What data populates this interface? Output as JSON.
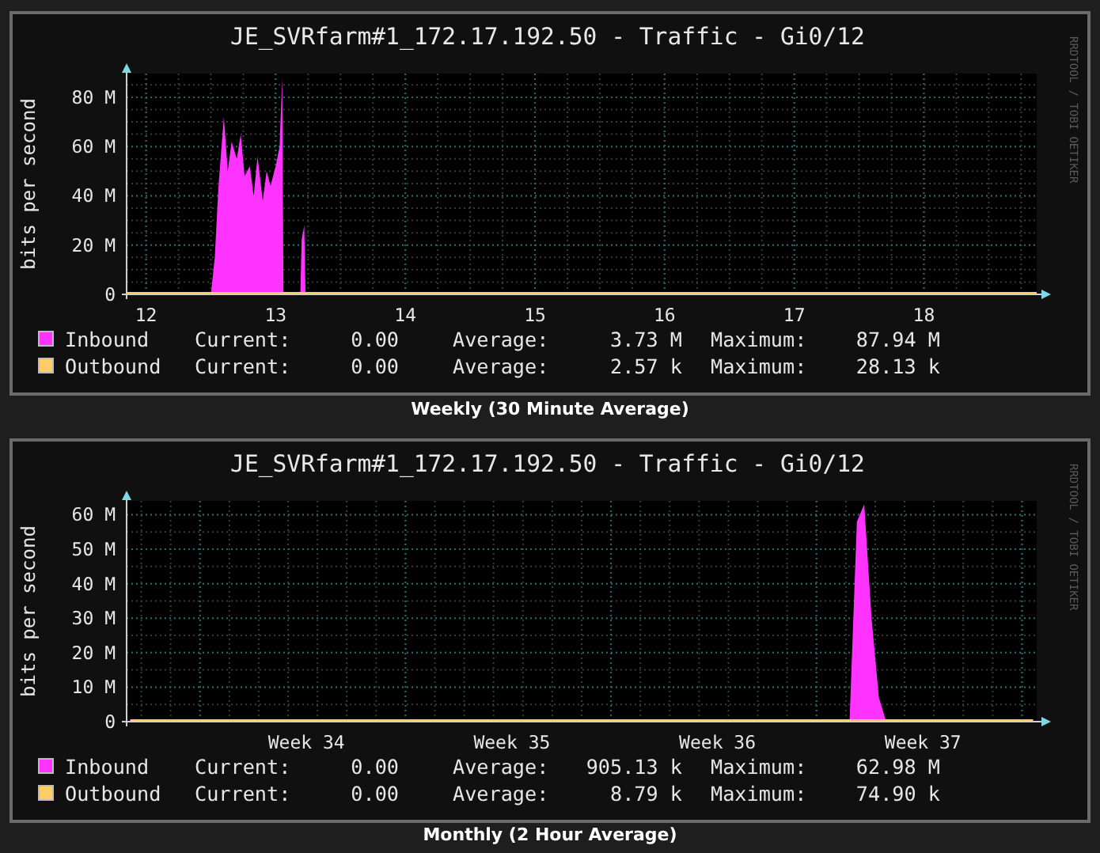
{
  "graphs": [
    {
      "title": "JE_SVRfarm#1_172.17.192.50 - Traffic - Gi0/12",
      "credit": "RRDTOOL / TOBI OETIKER",
      "caption": "Weekly (30 Minute Average)",
      "chart_data": {
        "type": "area",
        "ylabel": "bits per second",
        "grid": true,
        "legend": "bottom",
        "xlim": [
          11.85,
          18.87
        ],
        "ylim": [
          0,
          89.6
        ],
        "x": [
          11.85,
          12.5,
          12.53,
          12.56,
          12.6,
          12.63,
          12.66,
          12.7,
          12.73,
          12.76,
          12.8,
          12.83,
          12.86,
          12.9,
          12.93,
          12.96,
          13.0,
          13.03,
          13.05,
          13.06,
          13.19,
          13.2,
          13.22,
          13.23,
          18.87
        ],
        "series": [
          {
            "name": "Inbound",
            "color": "#ff33ff",
            "values": [
              0,
              0,
              15,
              45,
              72,
              50,
              62,
              55,
              65,
              48,
              52,
              40,
              56,
              38,
              50,
              44,
              52,
              60,
              88,
              0,
              0,
              22,
              28,
              0,
              0
            ]
          },
          {
            "name": "Outbound",
            "color": "#ffcc66",
            "values": [
              0,
              0,
              0,
              0,
              0,
              0,
              0,
              0,
              0,
              0,
              0,
              0,
              0,
              0,
              0,
              0,
              0,
              0,
              0,
              0,
              0,
              0,
              0,
              0,
              0
            ]
          }
        ],
        "xticks": [
          12,
          13,
          14,
          15,
          16,
          17,
          18
        ],
        "yticks": [
          {
            "value": 0,
            "label": "0"
          },
          {
            "value": 20,
            "label": "20 M"
          },
          {
            "value": 40,
            "label": "40 M"
          },
          {
            "value": 60,
            "label": "60 M"
          },
          {
            "value": 80,
            "label": "80 M"
          }
        ]
      },
      "legend": [
        {
          "current_label": "Current:",
          "current": "0.00",
          "average_label": "Average:",
          "average": "3.73 M",
          "maximum_label": "Maximum:",
          "maximum": "87.94 M"
        },
        {
          "current_label": "Current:",
          "current": "0.00",
          "average_label": "Average:",
          "average": "2.57 k",
          "maximum_label": "Maximum:",
          "maximum": "28.13 k"
        }
      ]
    },
    {
      "title": "JE_SVRfarm#1_172.17.192.50 - Traffic - Gi0/12",
      "credit": "RRDTOOL / TOBI OETIKER",
      "caption": "Monthly (2 Hour Average)",
      "chart_data": {
        "type": "area",
        "ylabel": "bits per second",
        "grid": true,
        "legend": "bottom",
        "ylim": [
          0,
          64
        ],
        "categories": [
          null,
          null,
          null,
          null,
          null,
          null,
          null,
          null,
          null,
          null,
          null,
          null,
          null,
          null,
          null,
          null,
          null,
          null,
          null,
          null,
          null,
          null,
          null,
          null,
          "Week 34",
          null,
          null,
          null,
          null,
          null,
          null,
          null,
          null,
          null,
          null,
          null,
          null,
          null,
          null,
          null,
          null,
          null,
          null,
          null,
          null,
          null,
          null,
          null,
          null,
          null,
          null,
          null,
          "Week 35",
          null,
          null,
          null,
          null,
          null,
          null,
          null,
          null,
          null,
          null,
          null,
          null,
          null,
          null,
          null,
          null,
          null,
          null,
          null,
          null,
          null,
          null,
          null,
          null,
          null,
          null,
          null,
          "Week 36",
          null,
          null,
          null,
          null,
          null,
          null,
          null,
          null,
          null,
          null,
          null,
          null,
          null,
          null,
          null,
          null,
          null,
          null,
          null,
          null,
          null,
          null,
          null,
          null,
          null,
          null,
          null,
          "Week 37",
          null,
          null,
          null,
          null,
          null,
          null,
          null,
          null,
          null,
          null,
          null,
          null,
          null,
          null,
          null
        ],
        "series": [
          {
            "name": "Inbound",
            "color": "#ff33ff",
            "values": [
              0,
              0,
              0,
              0,
              0,
              0,
              0,
              0,
              0,
              0,
              0,
              0,
              0,
              0,
              0,
              0,
              0,
              0,
              0,
              0,
              0,
              0,
              0,
              0,
              0,
              0,
              0,
              0,
              0,
              0,
              0,
              0,
              0,
              0,
              0,
              0,
              0,
              0,
              0,
              0,
              0,
              0,
              0,
              0,
              0,
              0,
              0,
              0,
              0,
              0,
              0,
              0,
              0,
              0,
              0,
              0,
              0,
              0,
              0,
              0,
              0,
              0,
              0,
              0,
              0,
              0,
              0,
              0,
              0,
              0,
              0,
              0,
              0,
              0,
              0,
              0,
              0,
              0,
              0,
              0,
              0,
              0,
              0,
              0,
              0,
              0,
              0,
              0,
              0,
              0,
              0,
              0,
              0,
              0,
              0,
              0,
              0,
              0,
              0,
              58,
              63,
              30,
              7,
              0,
              0,
              0,
              0,
              0,
              0,
              0,
              0,
              0,
              0,
              0,
              0,
              0,
              0,
              0,
              0,
              0,
              0,
              0,
              0,
              0
            ]
          },
          {
            "name": "Outbound",
            "color": "#ffcc66",
            "values": [
              0,
              0,
              0,
              0,
              0,
              0,
              0,
              0,
              0,
              0,
              0,
              0,
              0,
              0,
              0,
              0,
              0,
              0,
              0,
              0,
              0,
              0,
              0,
              0,
              0,
              0,
              0,
              0,
              0,
              0,
              0,
              0,
              0,
              0,
              0,
              0,
              0,
              0,
              0,
              0,
              0,
              0,
              0,
              0,
              0,
              0,
              0,
              0,
              0,
              0,
              0,
              0,
              0,
              0,
              0,
              0,
              0,
              0,
              0,
              0,
              0,
              0,
              0,
              0,
              0,
              0,
              0,
              0,
              0,
              0,
              0,
              0,
              0,
              0,
              0,
              0,
              0,
              0,
              0,
              0,
              0,
              0,
              0,
              0,
              0,
              0,
              0,
              0,
              0,
              0,
              0,
              0,
              0,
              0,
              0,
              0,
              0,
              0,
              0,
              0,
              0,
              0,
              0,
              0,
              0,
              0,
              0,
              0,
              0,
              0,
              0,
              0,
              0,
              0,
              0,
              0,
              0,
              0,
              0,
              0,
              0,
              0,
              0,
              0
            ]
          }
        ],
        "yticks": [
          {
            "value": 0,
            "label": "0"
          },
          {
            "value": 10,
            "label": "10 M"
          },
          {
            "value": 20,
            "label": "20 M"
          },
          {
            "value": 30,
            "label": "30 M"
          },
          {
            "value": 40,
            "label": "40 M"
          },
          {
            "value": 50,
            "label": "50 M"
          },
          {
            "value": 60,
            "label": "60 M"
          }
        ]
      },
      "legend": [
        {
          "current_label": "Current:",
          "current": "0.00",
          "average_label": "Average:",
          "average": "905.13 k",
          "maximum_label": "Maximum:",
          "maximum": "62.98 M"
        },
        {
          "current_label": "Current:",
          "current": "0.00",
          "average_label": "Average:",
          "average": "8.79 k",
          "maximum_label": "Maximum:",
          "maximum": "74.90 k"
        }
      ]
    }
  ]
}
